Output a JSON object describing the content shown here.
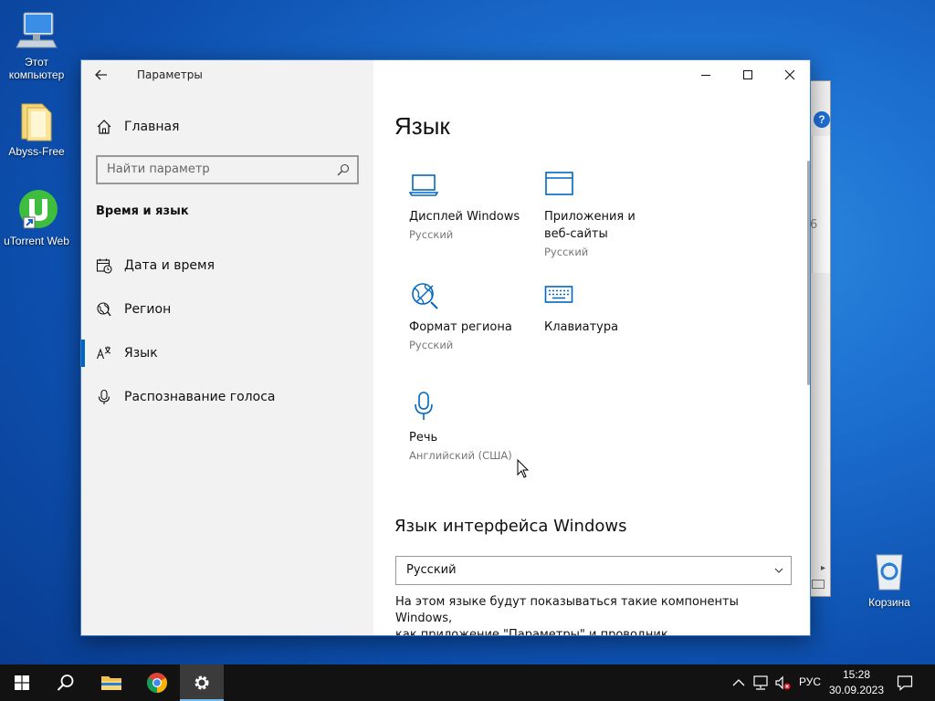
{
  "desktop": {
    "icons": [
      {
        "label_line1": "Этот",
        "label_line2": "компьютер"
      },
      {
        "label": "Abyss-Free"
      },
      {
        "label": "uTorrent Web"
      },
      {
        "label": "Корзина"
      }
    ]
  },
  "window": {
    "title": "Параметры",
    "controls": [
      "minimize",
      "maximize",
      "close"
    ]
  },
  "sidebar": {
    "home_label": "Главная",
    "search_placeholder": "Найти параметр",
    "section_title": "Время и язык",
    "items": [
      {
        "label": "Дата и время",
        "icon": "calendar-clock-icon"
      },
      {
        "label": "Регион",
        "icon": "globe-icon"
      },
      {
        "label": "Язык",
        "icon": "language-icon",
        "active": true
      },
      {
        "label": "Распознавание голоса",
        "icon": "microphone-icon"
      }
    ]
  },
  "main": {
    "title": "Язык",
    "tiles": [
      {
        "label": "Дисплей Windows",
        "sub": "Русский",
        "icon": "laptop-icon"
      },
      {
        "label_line1": "Приложения и",
        "label_line2": "веб-сайты",
        "sub": "Русский",
        "icon": "window-icon"
      },
      {
        "label": "Формат региона",
        "sub": "Русский",
        "icon": "globe-format-icon"
      },
      {
        "label": "Клавиатура",
        "sub": "",
        "icon": "keyboard-icon"
      },
      {
        "label": "Речь",
        "sub": "Английский (США)",
        "icon": "microphone-icon"
      }
    ],
    "interface_heading": "Язык интерфейса Windows",
    "interface_value": "Русский",
    "description_line1": "На этом языке будут показываться такие компоненты Windows,",
    "description_line2": "как приложение \"Параметры\" и проводник."
  },
  "taskbar": {
    "lang": "РУС",
    "time": "15:28",
    "date": "30.09.2023"
  },
  "colors": {
    "accent": "#0067c0",
    "icon_blue": "#0067c0",
    "taskbar": "#121212"
  }
}
